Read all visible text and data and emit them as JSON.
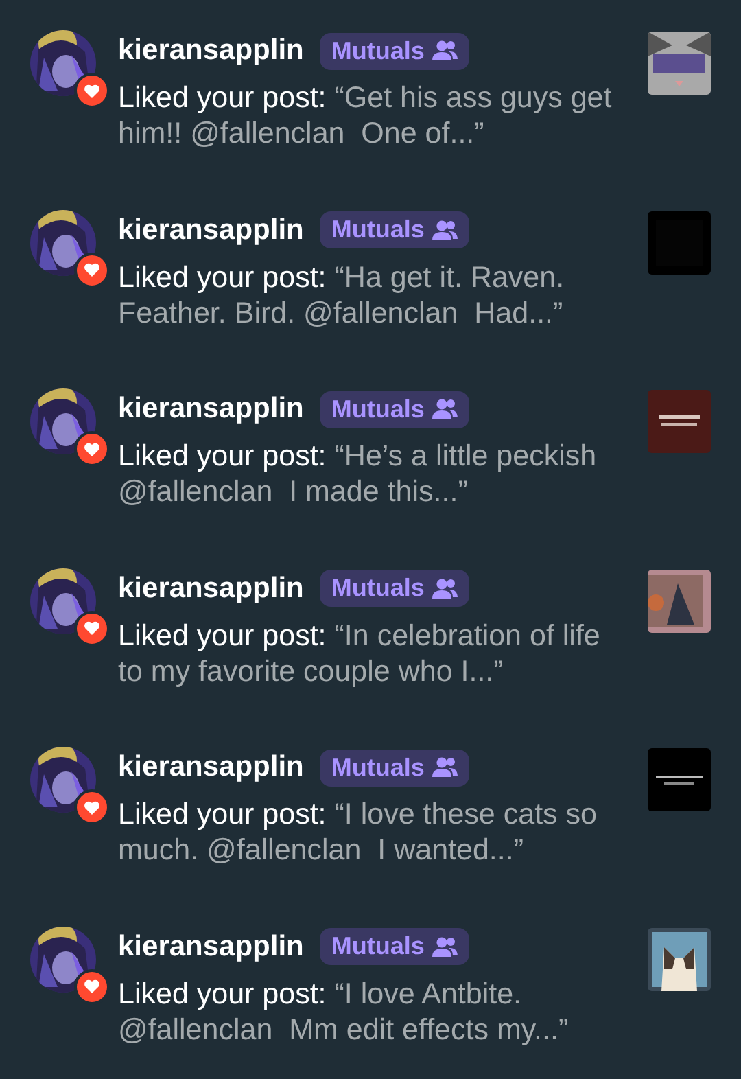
{
  "notifications": [
    {
      "username": "kieransapplin",
      "badge": "Mutuals",
      "action": "Liked your post:",
      "excerpt": "“Get his ass guys get him!! @fallenclan  One of...”"
    },
    {
      "username": "kieransapplin",
      "badge": "Mutuals",
      "action": "Liked your post:",
      "excerpt": "“Ha get it. Raven. Feather. Bird. @fallenclan  Had...”"
    },
    {
      "username": "kieransapplin",
      "badge": "Mutuals",
      "action": "Liked your post:",
      "excerpt": "“He’s a little peckish @fallenclan  I made this...”"
    },
    {
      "username": "kieransapplin",
      "badge": "Mutuals",
      "action": "Liked your post:",
      "excerpt": "“In celebration of life to my favorite couple who I...”"
    },
    {
      "username": "kieransapplin",
      "badge": "Mutuals",
      "action": "Liked your post:",
      "excerpt": "“I love these cats so much. @fallenclan  I wanted...”"
    },
    {
      "username": "kieransapplin",
      "badge": "Mutuals",
      "action": "Liked your post:",
      "excerpt": "“I love Antbite. @fallenclan  Mm edit effects my...”"
    }
  ]
}
